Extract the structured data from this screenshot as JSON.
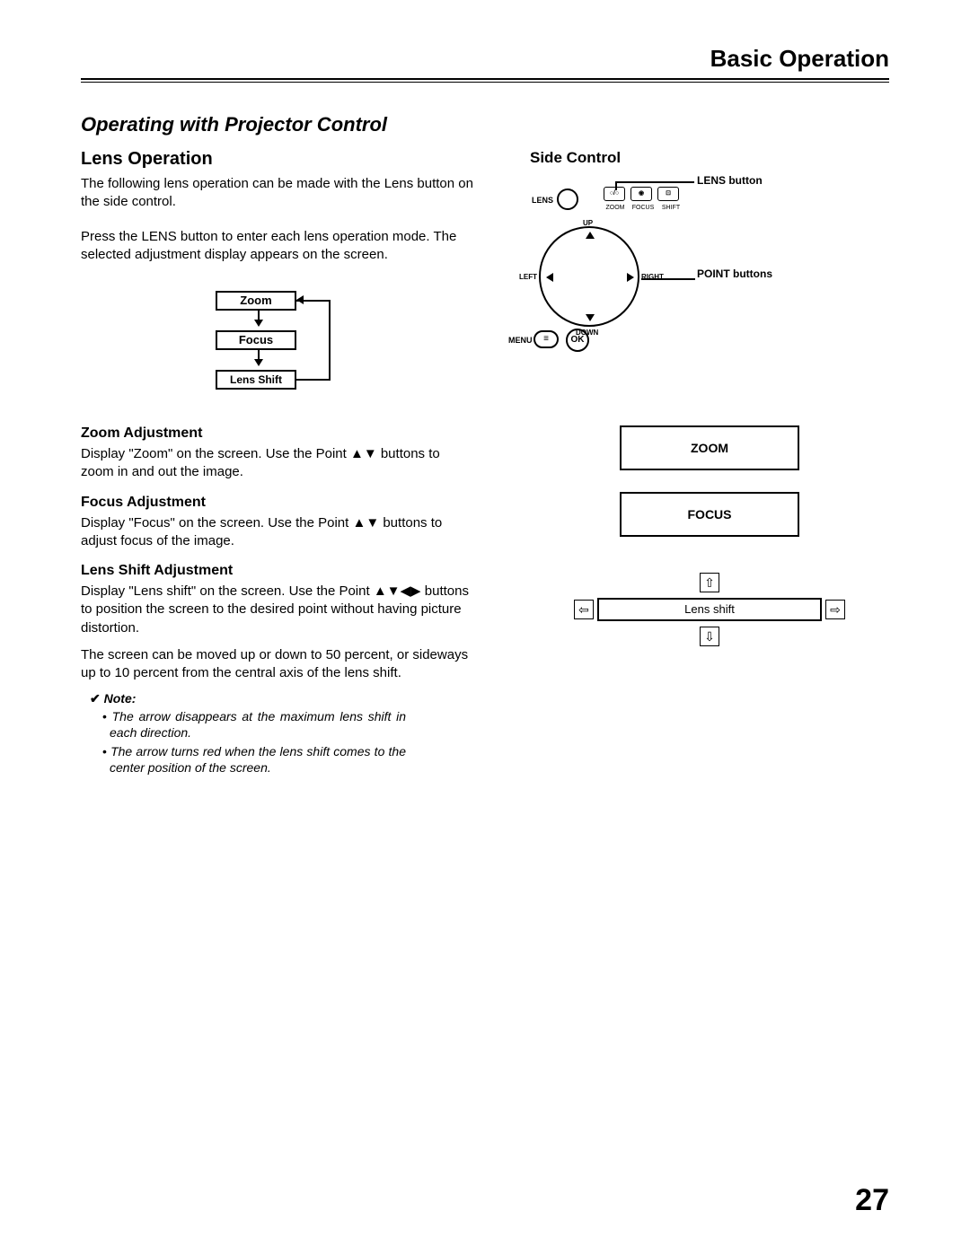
{
  "header": {
    "title": "Basic Operation"
  },
  "section_title": "Operating with Projector Control",
  "lens_op": {
    "heading": "Lens Operation",
    "p1": "The following lens operation can be made with the Lens button on the side control.",
    "p2": "Press the LENS button to enter each lens operation mode. The selected adjustment display appears on the screen."
  },
  "mode_cycle": {
    "zoom": "Zoom",
    "focus": "Focus",
    "lens_shift": "Lens Shift"
  },
  "zoom_adj": {
    "heading": "Zoom Adjustment",
    "text_a": "Display \"Zoom\" on the screen. Use the Point ",
    "text_b": " buttons to zoom in and out the image."
  },
  "focus_adj": {
    "heading": "Focus Adjustment",
    "text_a": "Display \"Focus\" on the screen. Use the Point ",
    "text_b": " buttons to adjust focus of the image."
  },
  "shift_adj": {
    "heading": "Lens Shift Adjustment",
    "text_a": "Display \"Lens shift\" on the screen. Use the Point ",
    "text_b": " buttons to position the screen to the desired point without having picture distortion.",
    "text_c": "The screen can be moved up or down to 50 percent, or sideways up to 10 percent from the central axis of the lens shift."
  },
  "note": {
    "label": "Note:",
    "n1": "The arrow disappears at the maximum lens shift in each direction.",
    "n2": "The arrow turns red when the lens shift comes to the center position of the screen."
  },
  "side_control": {
    "heading": "Side Control",
    "lens": "LENS",
    "up": "UP",
    "down": "DOWN",
    "left": "LEFT",
    "right": "RIGHT",
    "menu": "MENU",
    "ok": "OK",
    "zoom_i": "ZOOM",
    "focus_i": "FOCUS",
    "shift_i": "SHIFT",
    "callout_lens": "LENS button",
    "callout_point": "POINT buttons"
  },
  "osd": {
    "zoom": "ZOOM",
    "focus": "FOCUS",
    "lens_shift": "Lens shift"
  },
  "arrows": {
    "up": "⇧",
    "down": "⇩",
    "left": "⇦",
    "right": "⇨"
  },
  "menu_glyph": "≡",
  "page_number": "27"
}
